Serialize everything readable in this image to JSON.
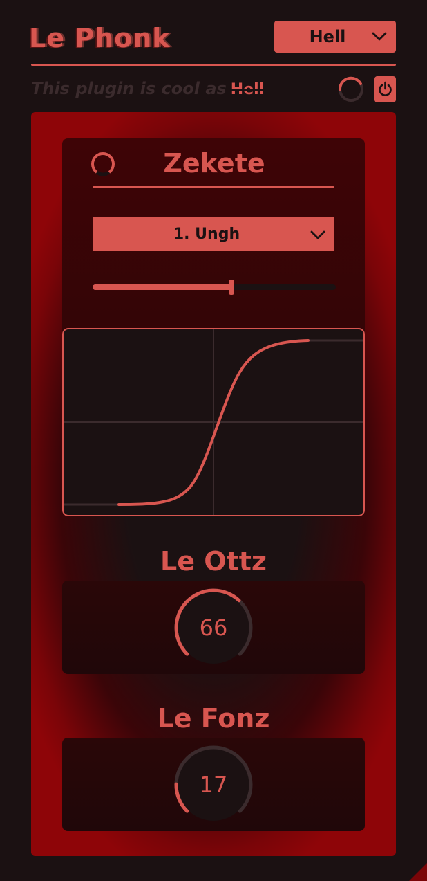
{
  "header": {
    "title": "Le Phonk",
    "preset_value": "Hell",
    "tagline_text": "This plugin is cool as",
    "tagline_accent": "Hell"
  },
  "zekete": {
    "title": "Zekete",
    "mode_value": "1. Ungh",
    "slider_fraction": 0.57
  },
  "knobs": [
    {
      "label": "Le Ottz",
      "value": "66",
      "fraction": 0.66
    },
    {
      "label": "Le Fonz",
      "value": "17",
      "fraction": 0.17
    }
  ],
  "icons": {
    "spinner": "loading-ring-icon",
    "power": "power-icon",
    "preset_chevron": "chevron-down-icon",
    "zekete_ring": "ring-icon"
  },
  "colors": {
    "accent": "#d85650",
    "background": "#1b1112",
    "panel_red": "#8e0508",
    "muted": "#3b2b2d"
  }
}
